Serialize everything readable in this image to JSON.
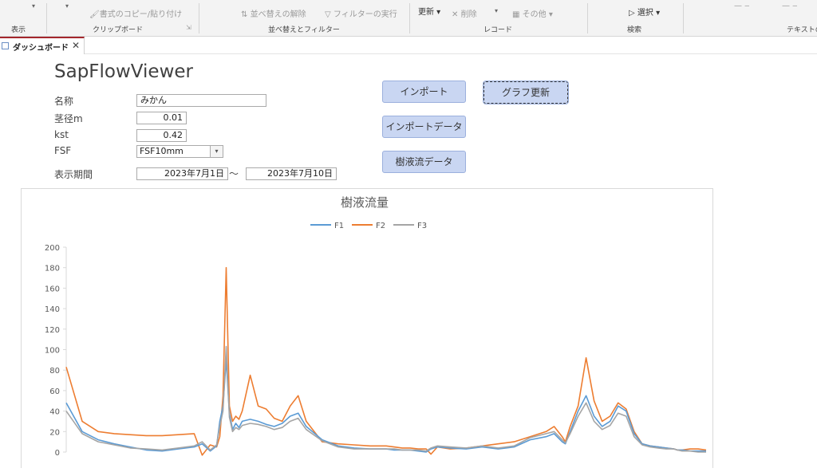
{
  "ribbon": {
    "view_label": "表示",
    "clipboard": {
      "format_painter": "書式のコピー/貼り付け",
      "group": "クリップボード"
    },
    "sort_filter": {
      "clear_sort": "並べ替えの解除",
      "run_filter": "フィルターの実行",
      "group": "並べ替えとフィルター"
    },
    "records": {
      "refresh": "更新",
      "delete": "削除",
      "more": "その他",
      "group": "レコード"
    },
    "find": {
      "select": "選択",
      "group": "検索"
    },
    "text_group": "テキストの"
  },
  "tab": {
    "label": "ダッシュボード"
  },
  "form": {
    "title": "SapFlowViewer",
    "name": {
      "label": "名称",
      "value": "みかん"
    },
    "stem": {
      "label": "茎径m",
      "value": "0.01"
    },
    "kst": {
      "label": "kst",
      "value": "0.42"
    },
    "fsf": {
      "label": "FSF",
      "value": "FSF10mm"
    },
    "period": {
      "label": "表示期間",
      "start": "2023年7月1日",
      "separator": "～",
      "end": "2023年7月10日"
    },
    "buttons": {
      "import": "インポート",
      "graph_update": "グラフ更新",
      "import_data": "インポートデータ",
      "sap_flow_data": "樹液流データ"
    }
  },
  "colors": {
    "F1": "#5b9bd5",
    "F2": "#ed7d31",
    "F3": "#a5a5a5",
    "button": "#c9d6f2"
  },
  "chart_data": {
    "type": "line",
    "title": "樹液流量",
    "xlabel": "",
    "ylabel": "",
    "ylim": [
      0,
      200
    ],
    "yticks": [
      0,
      20,
      40,
      60,
      80,
      100,
      120,
      140,
      160,
      180,
      200
    ],
    "grid": false,
    "legend": "top",
    "x": [
      0,
      10,
      20,
      30,
      40,
      50,
      60,
      70,
      80,
      85,
      90,
      94,
      96,
      98,
      100,
      102,
      104,
      106,
      108,
      110,
      115,
      120,
      125,
      130,
      135,
      140,
      145,
      150,
      160,
      170,
      180,
      190,
      200,
      205,
      210,
      215,
      220,
      225,
      228,
      232,
      240,
      250,
      260,
      270,
      280,
      290,
      300,
      305,
      310,
      312,
      315,
      320,
      325,
      330,
      335,
      340,
      345,
      350,
      355,
      360,
      365,
      370,
      375,
      380,
      382,
      385,
      390,
      395,
      400
    ],
    "series": [
      {
        "name": "F1",
        "values": [
          48,
          20,
          12,
          8,
          5,
          2,
          1,
          3,
          5,
          8,
          1,
          6,
          30,
          45,
          90,
          38,
          22,
          28,
          24,
          30,
          32,
          30,
          27,
          25,
          28,
          35,
          38,
          25,
          12,
          6,
          4,
          3,
          3,
          2,
          2,
          2,
          1,
          0,
          3,
          5,
          4,
          3,
          5,
          3,
          5,
          12,
          15,
          18,
          10,
          8,
          20,
          40,
          55,
          35,
          25,
          30,
          45,
          40,
          18,
          8,
          6,
          5,
          4,
          3,
          2,
          2,
          1,
          1,
          1
        ]
      },
      {
        "name": "F2",
        "values": [
          83,
          30,
          20,
          18,
          17,
          16,
          16,
          17,
          18,
          -3,
          7,
          5,
          15,
          55,
          180,
          45,
          30,
          35,
          32,
          40,
          75,
          45,
          42,
          33,
          30,
          45,
          55,
          30,
          10,
          8,
          7,
          6,
          6,
          5,
          4,
          4,
          3,
          3,
          -2,
          5,
          3,
          4,
          6,
          8,
          10,
          15,
          20,
          25,
          15,
          10,
          25,
          45,
          92,
          50,
          30,
          35,
          48,
          42,
          20,
          8,
          6,
          5,
          4,
          3,
          2,
          2,
          3,
          3,
          2
        ]
      },
      {
        "name": "F3",
        "values": [
          40,
          18,
          10,
          7,
          4,
          3,
          2,
          4,
          6,
          10,
          2,
          7,
          25,
          40,
          103,
          34,
          20,
          24,
          22,
          26,
          28,
          27,
          25,
          22,
          24,
          30,
          33,
          22,
          11,
          5,
          3,
          3,
          3,
          3,
          2,
          2,
          2,
          1,
          4,
          6,
          5,
          4,
          6,
          4,
          6,
          14,
          18,
          20,
          12,
          9,
          18,
          35,
          48,
          30,
          22,
          26,
          38,
          35,
          15,
          7,
          5,
          4,
          3,
          3,
          2,
          1,
          1,
          0,
          0
        ]
      }
    ]
  }
}
